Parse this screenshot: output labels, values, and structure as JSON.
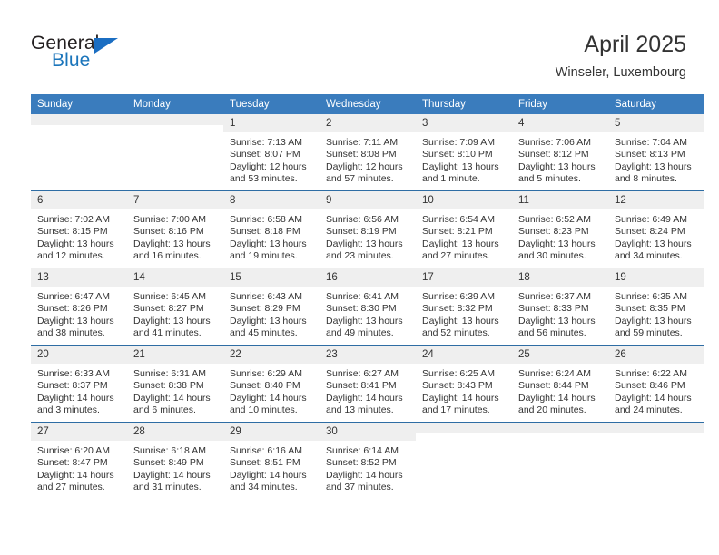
{
  "logo": {
    "word1": "General",
    "word2": "Blue",
    "triangle_color": "#1b6ec2",
    "blue_color": "#1b75bb"
  },
  "header": {
    "title": "April 2025",
    "subtitle": "Winseler, Luxembourg"
  },
  "theme": {
    "header_bg": "#3a7cbd",
    "row_divider": "#2e6da4",
    "daynum_bg": "#efefef",
    "text": "#333333"
  },
  "weekdays": [
    "Sunday",
    "Monday",
    "Tuesday",
    "Wednesday",
    "Thursday",
    "Friday",
    "Saturday"
  ],
  "weeks": [
    [
      {
        "day": "",
        "sunrise": "",
        "sunset": "",
        "daylight1": "",
        "daylight2": ""
      },
      {
        "day": "",
        "sunrise": "",
        "sunset": "",
        "daylight1": "",
        "daylight2": ""
      },
      {
        "day": "1",
        "sunrise": "Sunrise: 7:13 AM",
        "sunset": "Sunset: 8:07 PM",
        "daylight1": "Daylight: 12 hours",
        "daylight2": "and 53 minutes."
      },
      {
        "day": "2",
        "sunrise": "Sunrise: 7:11 AM",
        "sunset": "Sunset: 8:08 PM",
        "daylight1": "Daylight: 12 hours",
        "daylight2": "and 57 minutes."
      },
      {
        "day": "3",
        "sunrise": "Sunrise: 7:09 AM",
        "sunset": "Sunset: 8:10 PM",
        "daylight1": "Daylight: 13 hours",
        "daylight2": "and 1 minute."
      },
      {
        "day": "4",
        "sunrise": "Sunrise: 7:06 AM",
        "sunset": "Sunset: 8:12 PM",
        "daylight1": "Daylight: 13 hours",
        "daylight2": "and 5 minutes."
      },
      {
        "day": "5",
        "sunrise": "Sunrise: 7:04 AM",
        "sunset": "Sunset: 8:13 PM",
        "daylight1": "Daylight: 13 hours",
        "daylight2": "and 8 minutes."
      }
    ],
    [
      {
        "day": "6",
        "sunrise": "Sunrise: 7:02 AM",
        "sunset": "Sunset: 8:15 PM",
        "daylight1": "Daylight: 13 hours",
        "daylight2": "and 12 minutes."
      },
      {
        "day": "7",
        "sunrise": "Sunrise: 7:00 AM",
        "sunset": "Sunset: 8:16 PM",
        "daylight1": "Daylight: 13 hours",
        "daylight2": "and 16 minutes."
      },
      {
        "day": "8",
        "sunrise": "Sunrise: 6:58 AM",
        "sunset": "Sunset: 8:18 PM",
        "daylight1": "Daylight: 13 hours",
        "daylight2": "and 19 minutes."
      },
      {
        "day": "9",
        "sunrise": "Sunrise: 6:56 AM",
        "sunset": "Sunset: 8:19 PM",
        "daylight1": "Daylight: 13 hours",
        "daylight2": "and 23 minutes."
      },
      {
        "day": "10",
        "sunrise": "Sunrise: 6:54 AM",
        "sunset": "Sunset: 8:21 PM",
        "daylight1": "Daylight: 13 hours",
        "daylight2": "and 27 minutes."
      },
      {
        "day": "11",
        "sunrise": "Sunrise: 6:52 AM",
        "sunset": "Sunset: 8:23 PM",
        "daylight1": "Daylight: 13 hours",
        "daylight2": "and 30 minutes."
      },
      {
        "day": "12",
        "sunrise": "Sunrise: 6:49 AM",
        "sunset": "Sunset: 8:24 PM",
        "daylight1": "Daylight: 13 hours",
        "daylight2": "and 34 minutes."
      }
    ],
    [
      {
        "day": "13",
        "sunrise": "Sunrise: 6:47 AM",
        "sunset": "Sunset: 8:26 PM",
        "daylight1": "Daylight: 13 hours",
        "daylight2": "and 38 minutes."
      },
      {
        "day": "14",
        "sunrise": "Sunrise: 6:45 AM",
        "sunset": "Sunset: 8:27 PM",
        "daylight1": "Daylight: 13 hours",
        "daylight2": "and 41 minutes."
      },
      {
        "day": "15",
        "sunrise": "Sunrise: 6:43 AM",
        "sunset": "Sunset: 8:29 PM",
        "daylight1": "Daylight: 13 hours",
        "daylight2": "and 45 minutes."
      },
      {
        "day": "16",
        "sunrise": "Sunrise: 6:41 AM",
        "sunset": "Sunset: 8:30 PM",
        "daylight1": "Daylight: 13 hours",
        "daylight2": "and 49 minutes."
      },
      {
        "day": "17",
        "sunrise": "Sunrise: 6:39 AM",
        "sunset": "Sunset: 8:32 PM",
        "daylight1": "Daylight: 13 hours",
        "daylight2": "and 52 minutes."
      },
      {
        "day": "18",
        "sunrise": "Sunrise: 6:37 AM",
        "sunset": "Sunset: 8:33 PM",
        "daylight1": "Daylight: 13 hours",
        "daylight2": "and 56 minutes."
      },
      {
        "day": "19",
        "sunrise": "Sunrise: 6:35 AM",
        "sunset": "Sunset: 8:35 PM",
        "daylight1": "Daylight: 13 hours",
        "daylight2": "and 59 minutes."
      }
    ],
    [
      {
        "day": "20",
        "sunrise": "Sunrise: 6:33 AM",
        "sunset": "Sunset: 8:37 PM",
        "daylight1": "Daylight: 14 hours",
        "daylight2": "and 3 minutes."
      },
      {
        "day": "21",
        "sunrise": "Sunrise: 6:31 AM",
        "sunset": "Sunset: 8:38 PM",
        "daylight1": "Daylight: 14 hours",
        "daylight2": "and 6 minutes."
      },
      {
        "day": "22",
        "sunrise": "Sunrise: 6:29 AM",
        "sunset": "Sunset: 8:40 PM",
        "daylight1": "Daylight: 14 hours",
        "daylight2": "and 10 minutes."
      },
      {
        "day": "23",
        "sunrise": "Sunrise: 6:27 AM",
        "sunset": "Sunset: 8:41 PM",
        "daylight1": "Daylight: 14 hours",
        "daylight2": "and 13 minutes."
      },
      {
        "day": "24",
        "sunrise": "Sunrise: 6:25 AM",
        "sunset": "Sunset: 8:43 PM",
        "daylight1": "Daylight: 14 hours",
        "daylight2": "and 17 minutes."
      },
      {
        "day": "25",
        "sunrise": "Sunrise: 6:24 AM",
        "sunset": "Sunset: 8:44 PM",
        "daylight1": "Daylight: 14 hours",
        "daylight2": "and 20 minutes."
      },
      {
        "day": "26",
        "sunrise": "Sunrise: 6:22 AM",
        "sunset": "Sunset: 8:46 PM",
        "daylight1": "Daylight: 14 hours",
        "daylight2": "and 24 minutes."
      }
    ],
    [
      {
        "day": "27",
        "sunrise": "Sunrise: 6:20 AM",
        "sunset": "Sunset: 8:47 PM",
        "daylight1": "Daylight: 14 hours",
        "daylight2": "and 27 minutes."
      },
      {
        "day": "28",
        "sunrise": "Sunrise: 6:18 AM",
        "sunset": "Sunset: 8:49 PM",
        "daylight1": "Daylight: 14 hours",
        "daylight2": "and 31 minutes."
      },
      {
        "day": "29",
        "sunrise": "Sunrise: 6:16 AM",
        "sunset": "Sunset: 8:51 PM",
        "daylight1": "Daylight: 14 hours",
        "daylight2": "and 34 minutes."
      },
      {
        "day": "30",
        "sunrise": "Sunrise: 6:14 AM",
        "sunset": "Sunset: 8:52 PM",
        "daylight1": "Daylight: 14 hours",
        "daylight2": "and 37 minutes."
      },
      {
        "day": "",
        "sunrise": "",
        "sunset": "",
        "daylight1": "",
        "daylight2": ""
      },
      {
        "day": "",
        "sunrise": "",
        "sunset": "",
        "daylight1": "",
        "daylight2": ""
      },
      {
        "day": "",
        "sunrise": "",
        "sunset": "",
        "daylight1": "",
        "daylight2": ""
      }
    ]
  ]
}
